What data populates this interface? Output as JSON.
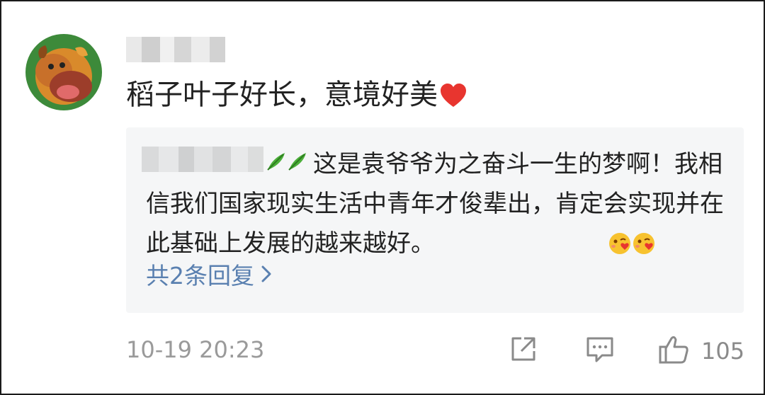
{
  "comment": {
    "text": "稻子叶子好长，意境好美",
    "timestamp": "10-19 20:23",
    "like_count": "105"
  },
  "reply_preview": {
    "text": "这是袁爷爷为之奋斗一生的梦啊！我相信我们国家现实生活中青年才俊辈出，肯定会实现并在此基础上发展的越来越好。",
    "more_replies_label": "共2条回复"
  },
  "icons": {
    "heart": "heart-icon",
    "leaf": "leaf-icon",
    "emoji": "face-blowing-kiss-icon",
    "share": "share-icon",
    "comment": "comment-icon",
    "like": "thumbs-up-icon",
    "chevron": "chevron-right-icon"
  },
  "colors": {
    "link": "#5a80b0",
    "meta": "#9a9a9a",
    "reply_bg": "#f5f6f7",
    "heart": "#e8352f"
  }
}
